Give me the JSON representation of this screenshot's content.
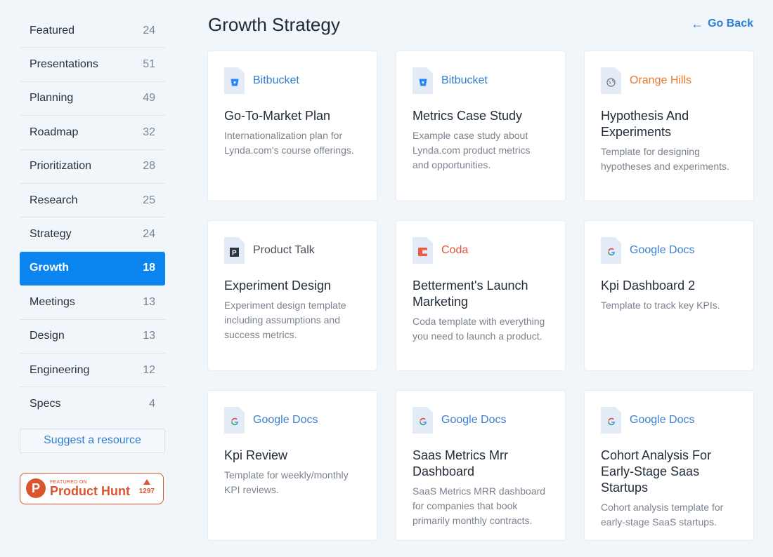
{
  "sidebar": {
    "categories": [
      {
        "label": "Featured",
        "count": "24"
      },
      {
        "label": "Presentations",
        "count": "51"
      },
      {
        "label": "Planning",
        "count": "49"
      },
      {
        "label": "Roadmap",
        "count": "32"
      },
      {
        "label": "Prioritization",
        "count": "28"
      },
      {
        "label": "Research",
        "count": "25"
      },
      {
        "label": "Strategy",
        "count": "24"
      },
      {
        "label": "Growth",
        "count": "18"
      },
      {
        "label": "Meetings",
        "count": "13"
      },
      {
        "label": "Design",
        "count": "13"
      },
      {
        "label": "Engineering",
        "count": "12"
      },
      {
        "label": "Specs",
        "count": "4"
      }
    ],
    "active_index": 7,
    "suggest_label": "Suggest a resource",
    "product_hunt": {
      "small_text": "FEATURED ON",
      "name": "Product Hunt",
      "logo_letter": "P",
      "votes": "1297"
    }
  },
  "header": {
    "title": "Growth Strategy",
    "go_back_label": "Go Back",
    "go_back_icon": "arrow-left-icon"
  },
  "colors": {
    "accent": "#0a84ef",
    "link": "#2b7fd4",
    "bitbucket": "#2f7fd0",
    "orange_hills": "#e57a2c",
    "coda": "#e5533d",
    "product_talk": "#4b525b",
    "google_docs": "#3e81cf",
    "product_hunt": "#da552f"
  },
  "cards": [
    {
      "source": "Bitbucket",
      "source_color": "#2f7fd0",
      "icon": "bitbucket-icon",
      "title": "Go-To-Market Plan",
      "description": "Internationalization plan for Lynda.com's course offerings."
    },
    {
      "source": "Bitbucket",
      "source_color": "#2f7fd0",
      "icon": "bitbucket-icon",
      "title": "Metrics Case Study",
      "description": "Example case study about Lynda.com product metrics and opportunities."
    },
    {
      "source": "Orange Hills",
      "source_color": "#e57a2c",
      "icon": "globe-icon",
      "title": "Hypothesis And Experiments",
      "description": "Template for designing hypotheses and experiments."
    },
    {
      "source": "Product Talk",
      "source_color": "#4b525b",
      "icon": "product-talk-icon",
      "title": "Experiment Design",
      "description": "Experiment design template including assumptions and success metrics."
    },
    {
      "source": "Coda",
      "source_color": "#e5533d",
      "icon": "coda-icon",
      "title": "Betterment's Launch Marketing",
      "description": "Coda template with everything you need to launch a product."
    },
    {
      "source": "Google Docs",
      "source_color": "#3e81cf",
      "icon": "google-icon",
      "title": "Kpi Dashboard 2",
      "description": "Template to track key KPIs."
    },
    {
      "source": "Google Docs",
      "source_color": "#3e81cf",
      "icon": "google-icon",
      "title": "Kpi Review",
      "description": "Template for weekly/monthly KPI reviews."
    },
    {
      "source": "Google Docs",
      "source_color": "#3e81cf",
      "icon": "google-icon",
      "title": "Saas Metrics Mrr Dashboard",
      "description": "SaaS Metrics MRR dashboard for companies that book primarily monthly contracts."
    },
    {
      "source": "Google Docs",
      "source_color": "#3e81cf",
      "icon": "google-icon",
      "title": "Cohort Analysis For Early-Stage Saas Startups",
      "description": "Cohort analysis template for early-stage SaaS startups."
    }
  ]
}
